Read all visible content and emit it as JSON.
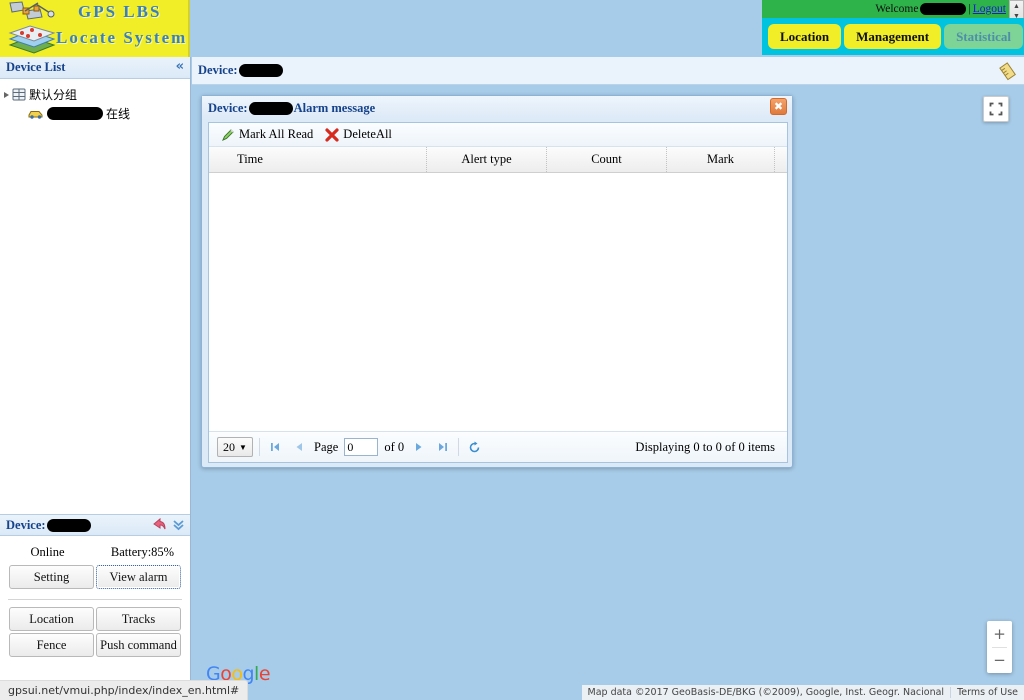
{
  "brand": {
    "line1": "GPS  LBS",
    "line2": "Locate System",
    "satellite_icon": "satellite-icon",
    "layers_icon": "map-layers-icon"
  },
  "header": {
    "welcome_label": "Welcome",
    "username_redacted": "",
    "separator": "|",
    "logout_label": "Logout",
    "tabs": [
      {
        "label": "Location",
        "state": "active"
      },
      {
        "label": "Management",
        "state": "inactive"
      },
      {
        "label": "Statistical",
        "state": "disabled"
      }
    ],
    "colors": {
      "welcome_bg": "#2eb24a",
      "nav_bg": "#00c3e0",
      "tab_yellow": "#f1ee27",
      "tab_green": "#7ed396",
      "logo_bg": "#f1ee27",
      "logo_text": "#3a7fb8"
    }
  },
  "sidebar": {
    "title": "Device List",
    "collapse_icon": "collapse-left-icon",
    "tree": [
      {
        "label": "默认分组",
        "icon": "group-icon",
        "expander": "expanded",
        "level": 0
      },
      {
        "label": "在线",
        "icon": "car-icon",
        "level": 1,
        "name_redacted": ""
      }
    ]
  },
  "device_panel": {
    "title": "Device:",
    "name_redacted": "",
    "back_icon": "back-arrow-icon",
    "expand_icon": "chevron-double-down-icon",
    "status": "Online",
    "battery": "Battery:85%",
    "buttons_top": [
      {
        "label": "Setting",
        "focused": false
      },
      {
        "label": "View alarm",
        "focused": true
      }
    ],
    "buttons_grid": [
      {
        "label": "Location"
      },
      {
        "label": "Tracks"
      },
      {
        "label": "Fence"
      },
      {
        "label": "Push command"
      }
    ]
  },
  "content": {
    "breadcrumb_label": "Device:",
    "breadcrumb_redacted": "",
    "ruler_icon": "ruler-measure-icon"
  },
  "alarm_window": {
    "title_prefix": "Device:",
    "title_redacted": "",
    "title_suffix": "Alarm message",
    "close_icon": "close-icon",
    "toolbar": [
      {
        "label": "Mark All Read",
        "icon": "pencil-icon"
      },
      {
        "label": "DeleteAll",
        "icon": "red-x-icon"
      }
    ],
    "grid": {
      "columns": [
        "Time",
        "Alert type",
        "Count",
        "Mark"
      ],
      "rows": []
    },
    "pager": {
      "page_size": "20",
      "page_size_caret": "▼",
      "first_icon": "first-page-icon",
      "prev_icon": "prev-page-icon",
      "page_label": "Page",
      "page_value": "0",
      "of_label": "of 0",
      "next_icon": "next-page-icon",
      "last_icon": "last-page-icon",
      "refresh_icon": "refresh-icon",
      "display_text": "Displaying 0 to 0 of 0 items"
    }
  },
  "map": {
    "fullscreen_icon": "fullscreen-icon",
    "zoom_in": "+",
    "zoom_out": "−",
    "google_logo": [
      "G",
      "o",
      "o",
      "g",
      "l",
      "e"
    ],
    "attribution": "Map data ©2017 GeoBasis-DE/BKG (©2009), Google, Inst. Geogr. Nacional",
    "terms": "Terms of Use",
    "background_color": "#a7cce9"
  },
  "statusbar": {
    "url": "gpsui.net/vmui.php/index/index_en.html#"
  }
}
